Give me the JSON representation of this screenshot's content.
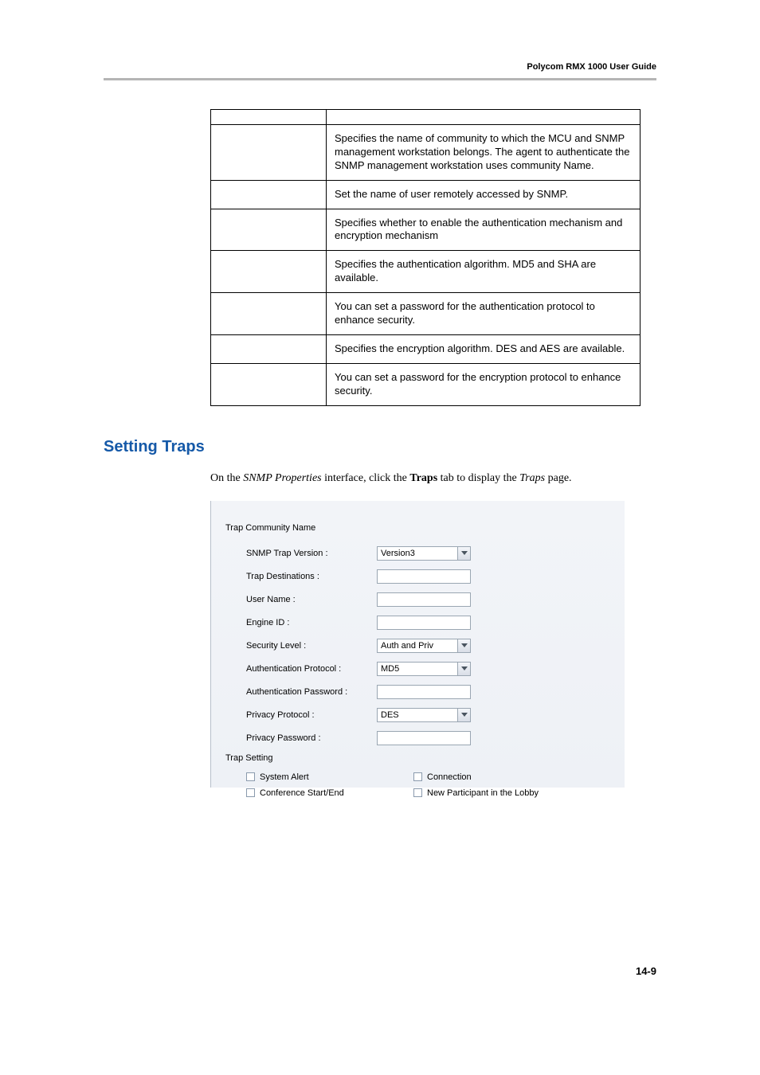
{
  "header": {
    "title": "Polycom RMX 1000 User Guide"
  },
  "table": {
    "rows": [
      {
        "left": "",
        "right": ""
      },
      {
        "left": "",
        "right": "Specifies the name of community to which the MCU and SNMP management workstation belongs. The agent to authenticate the SNMP management workstation uses community Name."
      },
      {
        "left": "",
        "right": "Set the name of user remotely accessed by SNMP."
      },
      {
        "left": "",
        "right": "Specifies whether to enable the authentication mechanism and encryption mechanism"
      },
      {
        "left": "",
        "right": "Specifies the authentication algorithm. MD5 and SHA are available."
      },
      {
        "left": "",
        "right": "You can set a password for the authentication protocol to enhance security."
      },
      {
        "left": "",
        "right": "Specifies the encryption algorithm. DES and AES are available."
      },
      {
        "left": "",
        "right": "You can set a password for the encryption protocol to enhance security."
      }
    ]
  },
  "section": {
    "heading": "Setting Traps",
    "body_pre": "On the ",
    "body_italic1": "SNMP Properties",
    "body_mid": " interface, click the ",
    "body_bold": "Traps",
    "body_mid2": " tab to display the ",
    "body_italic2": "Traps",
    "body_post": " page."
  },
  "screenshot": {
    "section1_label": "Trap Community Name",
    "fields": {
      "snmp_trap_version": {
        "label": "SNMP Trap Version :",
        "value": "Version3",
        "type": "select"
      },
      "trap_destinations": {
        "label": "Trap Destinations :",
        "value": "",
        "type": "input"
      },
      "user_name": {
        "label": "User Name :",
        "value": "",
        "type": "input"
      },
      "engine_id": {
        "label": "Engine ID :",
        "value": "",
        "type": "input"
      },
      "security_level": {
        "label": "Security Level :",
        "value": "Auth and Priv",
        "type": "select"
      },
      "auth_protocol": {
        "label": "Authentication Protocol :",
        "value": "MD5",
        "type": "select"
      },
      "auth_password": {
        "label": "Authentication Password :",
        "value": "",
        "type": "input"
      },
      "privacy_protocol": {
        "label": "Privacy Protocol :",
        "value": "DES",
        "type": "select"
      },
      "privacy_password": {
        "label": "Privacy Password :",
        "value": "",
        "type": "input"
      }
    },
    "section2_label": "Trap Setting",
    "checks": {
      "system_alert": "System Alert",
      "connection": "Connection",
      "conf_start_end": "Conference Start/End",
      "new_participant": "New Participant in the Lobby"
    }
  },
  "footer": {
    "page_number": "14-9"
  }
}
